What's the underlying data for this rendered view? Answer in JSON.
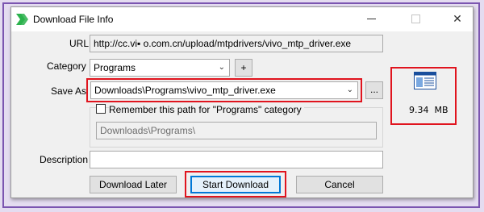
{
  "window": {
    "title": "Download File Info",
    "icon": "green-double-chevron-icon",
    "controls": [
      "minimize",
      "maximize",
      "close"
    ]
  },
  "form": {
    "url_label": "URL",
    "url_value": "http://cc.vi▪ o.com.cn/upload/mtpdrivers/vivo_mtp_driver.exe",
    "category_label": "Category",
    "category_value": "Programs",
    "add_category_label": "+",
    "save_as_label": "Save As",
    "save_as_value": "Downloads\\Programs\\vivo_mtp_driver.exe",
    "browse_label": "...",
    "remember_label": "Remember this path for \"Programs\" category",
    "remember_checked": false,
    "remember_path": "Downloads\\Programs\\",
    "description_label": "Description",
    "description_value": ""
  },
  "file_info": {
    "size": "9.34  MB",
    "icon": "file-type-icon"
  },
  "buttons": {
    "later": "Download Later",
    "start": "Start Download",
    "cancel": "Cancel"
  },
  "colors": {
    "highlight": "#e0141e",
    "frame": "#7b55b0",
    "focus": "#0078d7",
    "icon_green": "#2bb24c"
  }
}
